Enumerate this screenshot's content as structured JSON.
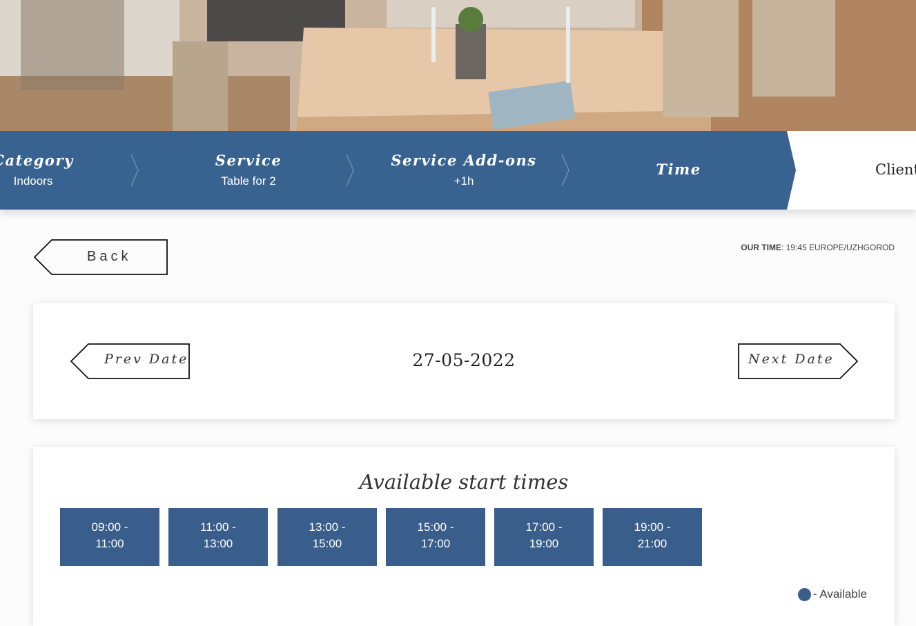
{
  "steps": [
    {
      "title": "Category",
      "sub": "Indoors"
    },
    {
      "title": "Service",
      "sub": "Table for 2"
    },
    {
      "title": "Service Add-ons",
      "sub": "+1h"
    },
    {
      "title": "Time",
      "sub": ""
    },
    {
      "title": "Client",
      "sub": ""
    }
  ],
  "back_label": "Back",
  "our_time": {
    "label": "OUR TIME",
    "value": ": 19:45 EUROPE/UZHGOROD"
  },
  "date_nav": {
    "prev_label": "Prev Date",
    "next_label": "Next Date",
    "current_date": "27-05-2022"
  },
  "times": {
    "title": "Available start times",
    "slots": [
      {
        "line1": "09:00 -",
        "line2": "11:00"
      },
      {
        "line1": "11:00 -",
        "line2": "13:00"
      },
      {
        "line1": "13:00 -",
        "line2": "15:00"
      },
      {
        "line1": "15:00 -",
        "line2": "17:00"
      },
      {
        "line1": "17:00 -",
        "line2": "19:00"
      },
      {
        "line1": "19:00 -",
        "line2": "21:00"
      }
    ],
    "legend_label": "- Available"
  },
  "colors": {
    "accent": "#386390",
    "slot": "#3a5e8c"
  }
}
